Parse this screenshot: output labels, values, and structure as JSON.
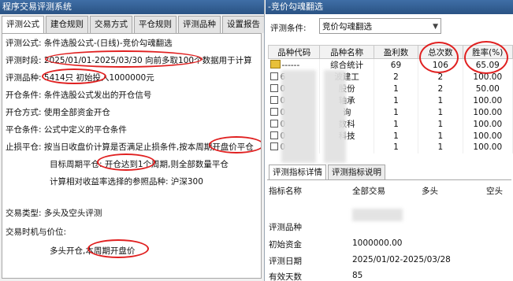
{
  "left": {
    "title": "程序交易评测系统",
    "tabs": [
      "评测公式",
      "建仓规则",
      "交易方式",
      "平仓规则",
      "评测品种",
      "设置报告"
    ],
    "lines": {
      "formula": "评测公式: 条件选股公式-(日线)-竞价勾魂翻选",
      "period": "评测时段: 2025/01/01-2025/03/30 向前多取100个数据用于计算",
      "variety_label": "评测品种:",
      "variety_value": "5414只 初始投入1000000元",
      "open_cond": "开仓条件: 条件选股公式发出的开仓信号",
      "open_way": "开仓方式: 使用全部资金开仓",
      "close_cond": "平仓条件: 公式中定义的平仓条件",
      "stop_close": "止损平仓: 按当日收盘价计算是否满足止损条件,按本周期开盘价平仓",
      "target_close": "目标周期平仓: 开仓达到1个周期,则全部数量平仓",
      "calc": "计算相对收益率选择的参照品种: 沪深300",
      "trade_type": "交易类型: 多头及空头评测",
      "trade_time": "交易时机与价位:",
      "long_open": "多头开仓,本周期开盘价"
    }
  },
  "right": {
    "title": "-竞价勾魂翻选",
    "condition_label": "评测条件:",
    "condition_value": "竞价勾魂翻选",
    "columns": [
      "品种代码",
      "品种名称",
      "盈利数",
      "总次数",
      "胜率(%)"
    ],
    "rows": [
      {
        "code": "------",
        "name": "综合统计",
        "win": "69",
        "total": "106",
        "rate": "65.09",
        "icon": "summary"
      },
      {
        "code": "6",
        "name": "波建工",
        "win": "2",
        "total": "2",
        "rate": "100.00",
        "icon": "checkbox"
      },
      {
        "code": "0",
        "name": "股份",
        "win": "1",
        "total": "2",
        "rate": "50.00",
        "icon": "checkbox"
      },
      {
        "code": "0",
        "name": "轴承",
        "win": "1",
        "total": "1",
        "rate": "100.00",
        "icon": "checkbox"
      },
      {
        "code": "0",
        "name": "询",
        "win": "1",
        "total": "1",
        "rate": "100.00",
        "icon": "checkbox"
      },
      {
        "code": "0",
        "name": "数科",
        "win": "1",
        "total": "1",
        "rate": "100.00",
        "icon": "checkbox"
      },
      {
        "code": "0",
        "name": "科技",
        "win": "1",
        "total": "1",
        "rate": "100.00",
        "icon": "checkbox"
      },
      {
        "code": "0",
        "name": "",
        "win": "1",
        "total": "1",
        "rate": "100.00",
        "icon": "checkbox"
      }
    ],
    "bottom_tabs": [
      "评测指标详情",
      "评测指标说明"
    ],
    "detail_headers": [
      "指标名称",
      "全部交易",
      "多头",
      "空头"
    ],
    "details": [
      {
        "name": "评测品种",
        "value": ""
      },
      {
        "name": "初始资金",
        "value": "1000000.00"
      },
      {
        "name": "评测日期",
        "value": "2025/01/02-2025/03/28"
      },
      {
        "name": "有效天数",
        "value": "85"
      }
    ]
  },
  "accent": {
    "title_bar": "#2f5d91",
    "annotation": "#e02020",
    "icon": "#e8c03a"
  }
}
